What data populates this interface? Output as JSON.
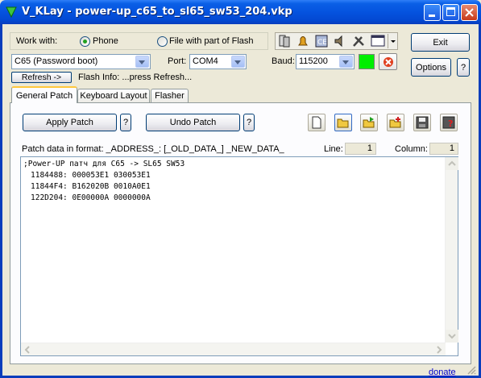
{
  "window": {
    "title": "V_KLay - power-up_c65_to_sl65_sw53_204.vkp"
  },
  "work_with": {
    "label": "Work with:",
    "option_phone": "Phone",
    "option_file": "File with part of Flash",
    "selected": "Phone"
  },
  "phone_model": {
    "value": "C65 (Password boot)"
  },
  "port": {
    "label": "Port:",
    "value": "COM4"
  },
  "baud": {
    "label": "Baud:",
    "value": "115200"
  },
  "status_color": "#00ee00",
  "buttons": {
    "exit": "Exit",
    "options": "Options",
    "help": "?",
    "refresh": "Refresh ->"
  },
  "flash_info": "Flash Info: ...press Refresh...",
  "tabs": [
    {
      "label": "General Patch",
      "active": true
    },
    {
      "label": "Keyboard Layout",
      "active": false
    },
    {
      "label": "Flasher",
      "active": false
    }
  ],
  "patch": {
    "apply": "Apply Patch",
    "undo": "Undo Patch",
    "help": "?",
    "format_text": "Patch data in format: _ADDRESS_: [_OLD_DATA_] _NEW_DATA_",
    "line_label": "Line:",
    "line_value": "1",
    "column_label": "Column:",
    "column_value": "1"
  },
  "editor": {
    "lines": [
      ";Power-UP патч для C65 -> SL65 SW53",
      "1184488: 000053E1 030053E1",
      "11844F4: B162020B 0010A0E1",
      "122D204: 0E00000A 0000000A"
    ]
  },
  "footer": {
    "donate": "donate"
  }
}
